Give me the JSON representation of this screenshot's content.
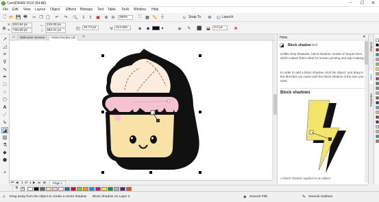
{
  "app": {
    "title": "CorelDRAW 2019 (64-Bit)"
  },
  "window_controls": {
    "minimize": "–",
    "maximize": "☐",
    "close": "✕"
  },
  "menu": [
    "File",
    "Edit",
    "View",
    "Layout",
    "Object",
    "Effects",
    "Bitmaps",
    "Text",
    "Table",
    "Tools",
    "Window",
    "Help"
  ],
  "toolbar": {
    "zoom": "260%",
    "snap_label": "Snap To",
    "launch_label": "Launch"
  },
  "props": {
    "x": "810.94 px",
    "y": "735.99 px",
    "w": "245.08 px",
    "h": "293.31 px",
    "offset_x": "29.73 px",
    "offset_y": "314.591",
    "transparency": "85",
    "feather": "0.0 px"
  },
  "tabs": [
    {
      "label": "Welcome Screen",
      "active": false
    },
    {
      "label": "Hints Docker.cdr",
      "active": true
    }
  ],
  "docker": {
    "header": "Hints",
    "tool_name": "Block shadow",
    "tool_suffix": "tool",
    "para1": "Unlike drop shadows, block shadow consist of simple lines, which makes them ideal for screen printing and sign making.",
    "para2": "In order to add a block shadow, click the object, and drag in the direction you want until the block shadow is the size you want.",
    "heading": "Block shadows",
    "caption": "A block shadow applied to an object"
  },
  "side_tabs": [
    "Objects",
    "Hints",
    "Properties"
  ],
  "page_bar": {
    "page_index": "1",
    "of_label": "of",
    "page_total": "1",
    "page_tab": "Page 1"
  },
  "status": {
    "hint": "Drag away from the object to create a vector shadow",
    "object": "Block Shadow on Layer 2",
    "fill": "Several Fills",
    "outline": "Several Outlines"
  },
  "colors": {
    "accent": "#1f6fb2",
    "shadow": "#111111",
    "frosting": "#fbeee0",
    "icing": "#f6c2d0",
    "cake": "#f9e2a8",
    "bolt": "#f3e46a"
  },
  "palette_colors": [
    "#ffffff",
    "#000000",
    "#e60012",
    "#00a0e9",
    "#ff7fbf",
    "#8fc31f",
    "#fff100",
    "#f39800",
    "#e4007f",
    "#009944",
    "#7f7f7f",
    "#b3b3b3",
    "#a0522d",
    "#1d2088",
    "#00b7ee",
    "#f8b551",
    "#c30d23",
    "#601986",
    "#cccccc",
    "#d7c447",
    "#00a29a",
    "#ea5514"
  ],
  "swatch_colors": [
    "#ffffff",
    "#000000",
    "#666666",
    "#f9e2a8",
    "#f6c2d0",
    "#fbeee0",
    "#1f6fb2",
    "#e60012",
    "#8fc31f",
    "#f39800",
    "#00a0e9",
    "#e4007f",
    "#fff100",
    "#009944",
    "#b3b3b3",
    "#601986",
    "#ea5514"
  ]
}
